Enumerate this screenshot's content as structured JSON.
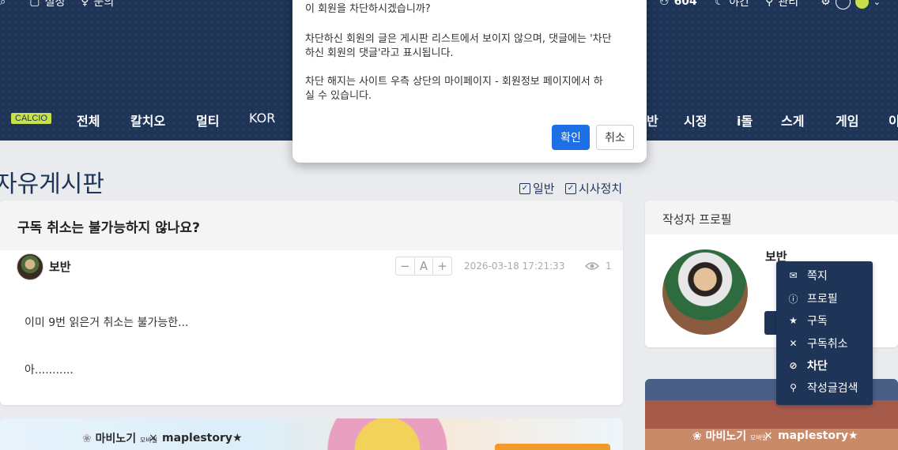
{
  "header": {
    "topbar_left": [
      {
        "icon": "bookmark-icon",
        "label": "설정"
      },
      {
        "icon": "lightbulb-icon",
        "label": "문의"
      }
    ],
    "topbar_right": [
      {
        "icon": "users-icon",
        "label": "604"
      },
      {
        "icon": "moon-icon",
        "label": "야간"
      },
      {
        "icon": "user-icon",
        "label": "관리"
      }
    ],
    "theme_colors": [
      "#ffffff",
      "#c8e04a"
    ]
  },
  "nav": {
    "badge": "CALCIO",
    "items": [
      "전체",
      "칼치오",
      "멀티",
      "KOR",
      "반",
      "시정",
      "i돌",
      "스게",
      "게임",
      "이"
    ]
  },
  "board": {
    "title": "자유게시판",
    "filters": [
      {
        "label": "일반",
        "checked": true
      },
      {
        "label": "시사정치",
        "checked": true
      }
    ]
  },
  "post": {
    "title": "구독 취소는 불가능하지 않나요?",
    "author": "보반",
    "font_controls": [
      "−",
      "A",
      "+"
    ],
    "date": "2026-03-18 17:21:33",
    "views": "1",
    "body": [
      "이미 9번 읽은거 취소는 불가능한...",
      "아..........."
    ]
  },
  "ads": {
    "left_brand": "마비노기",
    "left_brand_sub": "모바일",
    "x": "×",
    "left_partner": "maplestory★",
    "right_brand": "마비노기",
    "right_brand_sub": "모바일",
    "right_partner": "maplestory★"
  },
  "profile": {
    "header": "작성자 프로필",
    "name": "보반",
    "menu": [
      {
        "icon": "envelope-icon",
        "label": "쪽지"
      },
      {
        "icon": "info-icon",
        "label": "프로필"
      },
      {
        "icon": "star-icon",
        "label": "구독"
      },
      {
        "icon": "x-icon",
        "label": "구독취소"
      },
      {
        "icon": "ban-icon",
        "label": "차단"
      },
      {
        "icon": "search-icon",
        "label": "작성글검색"
      }
    ]
  },
  "modal": {
    "lines": [
      "이 회원을 차단하시겠습니까?",
      "",
      "차단하신 회원의 글은 게시판 리스트에서 보이지 않으며, 댓글에는 '차단",
      "하신 회원의 댓글'라고 표시됩니다.",
      "",
      "차단 해지는 사이트 우측 상단의 마이페이지 - 회원정보 페이지에서 하",
      "실 수 있습니다."
    ],
    "confirm": "확인",
    "cancel": "취소"
  }
}
